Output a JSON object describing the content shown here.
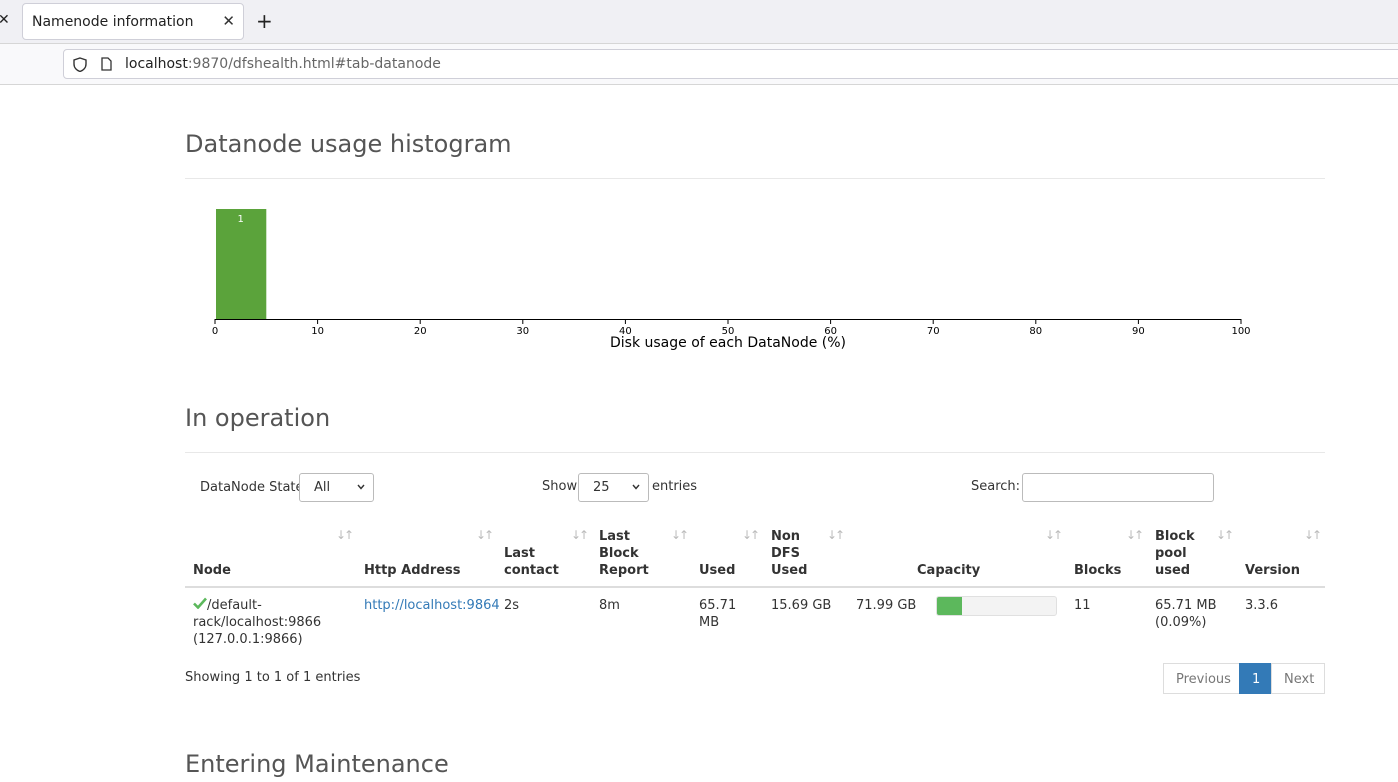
{
  "browser": {
    "tab_title": "Namenode information",
    "url_host": "localhost",
    "url_rest": ":9870/dfshealth.html#tab-datanode"
  },
  "histogram": {
    "heading": "Datanode usage histogram",
    "xlabel": "Disk usage of each DataNode (%)"
  },
  "chart_data": {
    "type": "bar",
    "title": "",
    "xlabel": "Disk usage of each DataNode (%)",
    "ylabel": "",
    "bins": [
      [
        0,
        5
      ]
    ],
    "values": [
      1
    ],
    "xlim": [
      0,
      100
    ],
    "xticks": [
      0,
      10,
      20,
      30,
      40,
      50,
      60,
      70,
      80,
      90,
      100
    ],
    "color": "#5ba33b"
  },
  "in_operation": {
    "heading": "In operation",
    "state_label": "DataNode State",
    "state_value": "All",
    "show_label": "Show",
    "entries_value": "25",
    "entries_label": "entries",
    "search_label": "Search:",
    "columns": [
      "Node",
      "Http Address",
      "Last contact",
      "Last Block Report",
      "Used",
      "Non DFS Used",
      "Capacity",
      "Blocks",
      "Block pool used",
      "Version"
    ],
    "row": {
      "node_l1": "/default-",
      "node_l2": "rack/localhost:9866",
      "node_l3": "(127.0.0.1:9866)",
      "http": "http://localhost:9864",
      "last_contact": "2s",
      "last_block_report": "8m",
      "used_l1": "65.71",
      "used_l2": "MB",
      "non_dfs": "15.69 GB",
      "capacity_text": "71.99 GB",
      "capacity_used_fraction": 0.21,
      "blocks": "11",
      "bpu_l1": "65.71 MB",
      "bpu_l2": "(0.09%)",
      "version": "3.3.6"
    },
    "info": "Showing 1 to 1 of 1 entries",
    "prev": "Previous",
    "page": "1",
    "next": "Next"
  },
  "maintenance": {
    "heading": "Entering Maintenance"
  }
}
